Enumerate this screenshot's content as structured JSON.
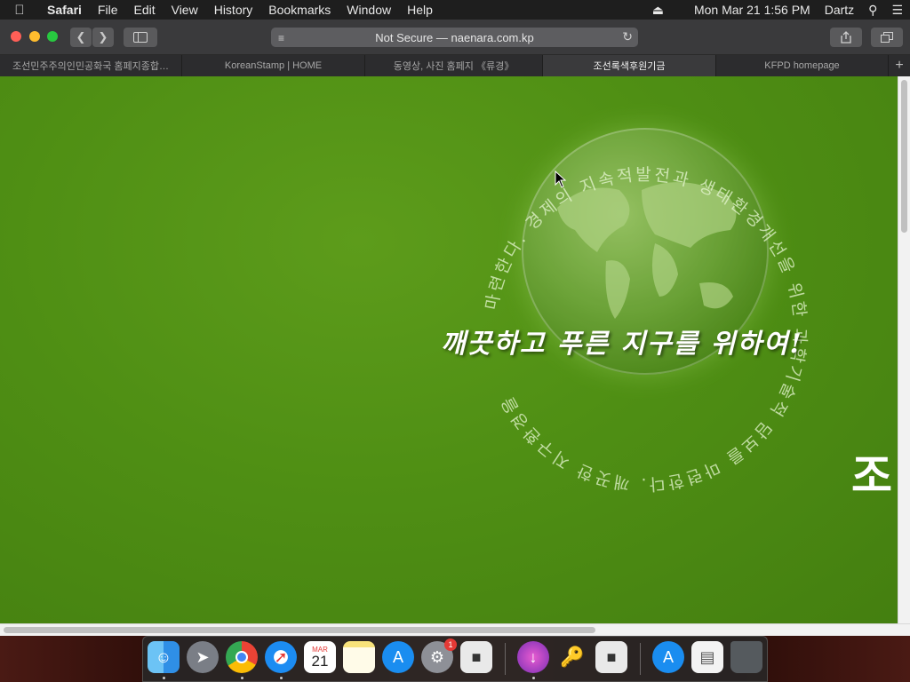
{
  "menubar": {
    "app": "Safari",
    "items": [
      "File",
      "Edit",
      "View",
      "History",
      "Bookmarks",
      "Window",
      "Help"
    ],
    "clock": "Mon Mar 21  1:56 PM",
    "user": "Dartz"
  },
  "toolbar": {
    "url": "Not Secure — naenara.com.kp"
  },
  "tabs": [
    {
      "title": "조선민주주의인민공화국 홈페지종합…",
      "active": false
    },
    {
      "title": "KoreanStamp | HOME",
      "active": false
    },
    {
      "title": "동영상, 사진 홈페지 《류경》",
      "active": false
    },
    {
      "title": "조선록색후원기금",
      "active": true
    },
    {
      "title": "KFPD homepage",
      "active": false
    }
  ],
  "page": {
    "slogan": "깨끗하고 푸른 지구를 위하여!",
    "ring_text": "마련한다. 경제의 지속적발전과 생태환경개선을 위한 과학기술적 담보를 마련한다. 깨끗한 지구환경을",
    "side_char": "조"
  },
  "dock": {
    "calendar_month": "MAR",
    "calendar_day": "21",
    "settings_badge": "1",
    "items": [
      "Finder",
      "Launchpad",
      "Chrome",
      "Safari",
      "Calendar",
      "Notes",
      "App Store",
      "System Preferences",
      "Roblox",
      "Installer",
      "Keychain Access",
      "Roblox Studio",
      "App Store",
      "Document",
      "Trash"
    ]
  },
  "colors": {
    "page_green": "#4f8f14",
    "menubar": "#1e1e1e",
    "toolbar": "#3a3a3c"
  }
}
